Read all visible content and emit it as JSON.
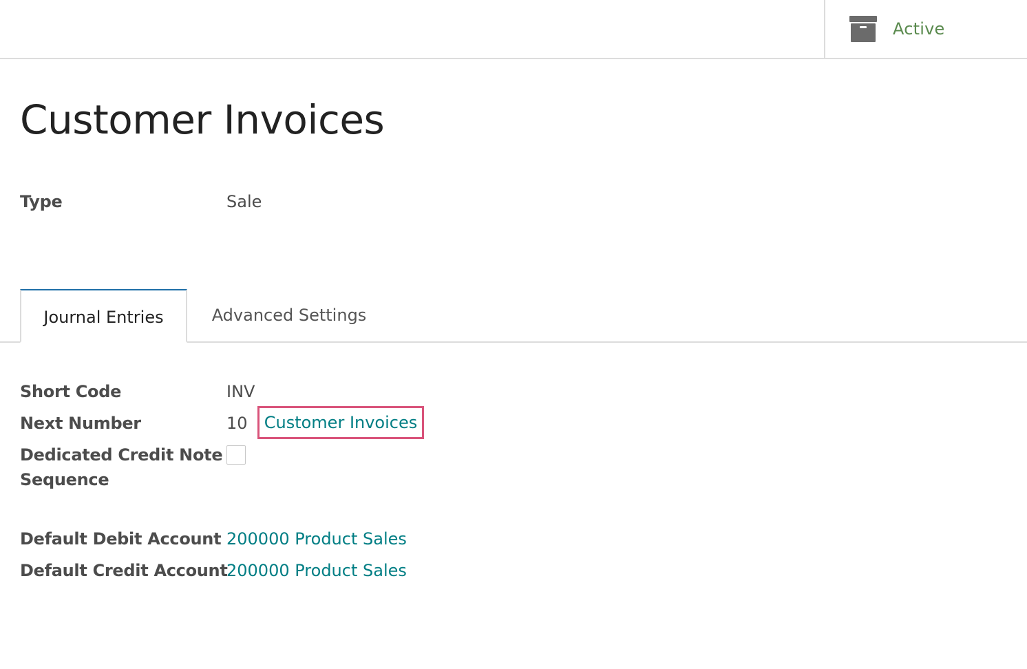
{
  "header": {
    "status_label": "Active",
    "status_icon": "archive-icon"
  },
  "form": {
    "title": "Customer Invoices",
    "type_label": "Type",
    "type_value": "Sale"
  },
  "tabs": [
    {
      "label": "Journal Entries",
      "active": true
    },
    {
      "label": "Advanced Settings",
      "active": false
    }
  ],
  "journal_entries": {
    "short_code_label": "Short Code",
    "short_code_value": "INV",
    "next_number_label": "Next Number",
    "next_number_value": "10",
    "sequence_link": "Customer Invoices",
    "credit_note_label_line1": "Dedicated Credit Note",
    "credit_note_label_line2": "Sequence",
    "credit_note_checked": false,
    "debit_account_label": "Default Debit Account",
    "debit_account_value": "200000 Product Sales",
    "credit_account_label": "Default Credit Account",
    "credit_account_value": "200000 Product Sales"
  },
  "colors": {
    "link": "#017e84",
    "status_active": "#5a8a4e",
    "highlight": "#d9537a",
    "tab_active_top": "#1f6fa8"
  }
}
